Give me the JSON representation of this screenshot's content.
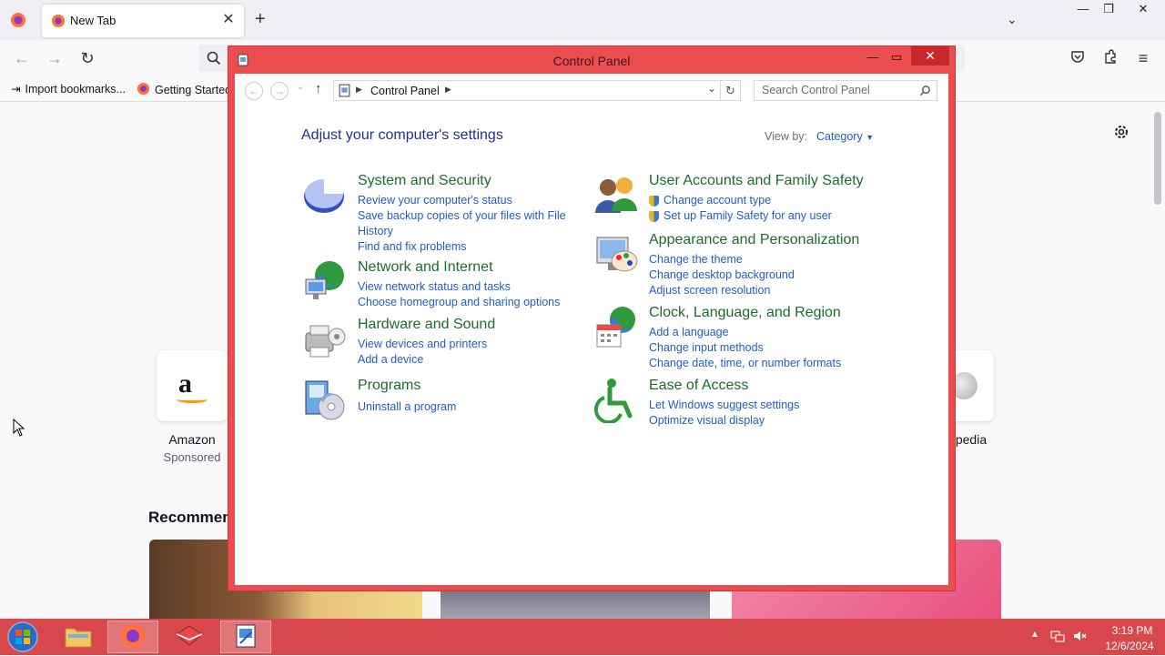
{
  "browser": {
    "tab_title": "New Tab",
    "bookmarks": [
      "Import bookmarks...",
      "Getting Started"
    ]
  },
  "newtab": {
    "shortcuts": [
      {
        "label": "Amazon",
        "sub": "Sponsored"
      },
      {
        "label": "pedia",
        "sub": ""
      }
    ],
    "recommended_title": "Recommen"
  },
  "control_panel": {
    "title": "Control Panel",
    "breadcrumb": "Control Panel",
    "search_placeholder": "Search Control Panel",
    "heading": "Adjust your computer's settings",
    "view_by_label": "View by:",
    "view_by_value": "Category",
    "categories": [
      {
        "title": "System and Security",
        "icon": "system-security-icon",
        "links": [
          "Review your computer's status",
          "Save backup copies of your files with File History",
          "Find and fix problems"
        ]
      },
      {
        "title": "Network and Internet",
        "icon": "network-internet-icon",
        "links": [
          "View network status and tasks",
          "Choose homegroup and sharing options"
        ]
      },
      {
        "title": "Hardware and Sound",
        "icon": "hardware-sound-icon",
        "links": [
          "View devices and printers",
          "Add a device"
        ]
      },
      {
        "title": "Programs",
        "icon": "programs-icon",
        "links": [
          "Uninstall a program"
        ]
      },
      {
        "title": "User Accounts and Family Safety",
        "icon": "user-accounts-icon",
        "links": [
          "Change account type",
          "Set up Family Safety for any user"
        ]
      },
      {
        "title": "Appearance and Personalization",
        "icon": "appearance-icon",
        "links": [
          "Change the theme",
          "Change desktop background",
          "Adjust screen resolution"
        ]
      },
      {
        "title": "Clock, Language, and Region",
        "icon": "clock-language-icon",
        "links": [
          "Add a language",
          "Change input methods",
          "Change date, time, or number formats"
        ]
      },
      {
        "title": "Ease of Access",
        "icon": "ease-of-access-icon",
        "links": [
          "Let Windows suggest settings",
          "Optimize visual display"
        ]
      }
    ]
  },
  "taskbar": {
    "time": "3:19 PM",
    "date": "12/6/2024"
  },
  "colors": {
    "window_frame": "#ec4d50",
    "taskbar": "#d8474b",
    "link": "#1e5ec8",
    "category_title": "#1b6d2a",
    "heading": "#1e3287"
  }
}
